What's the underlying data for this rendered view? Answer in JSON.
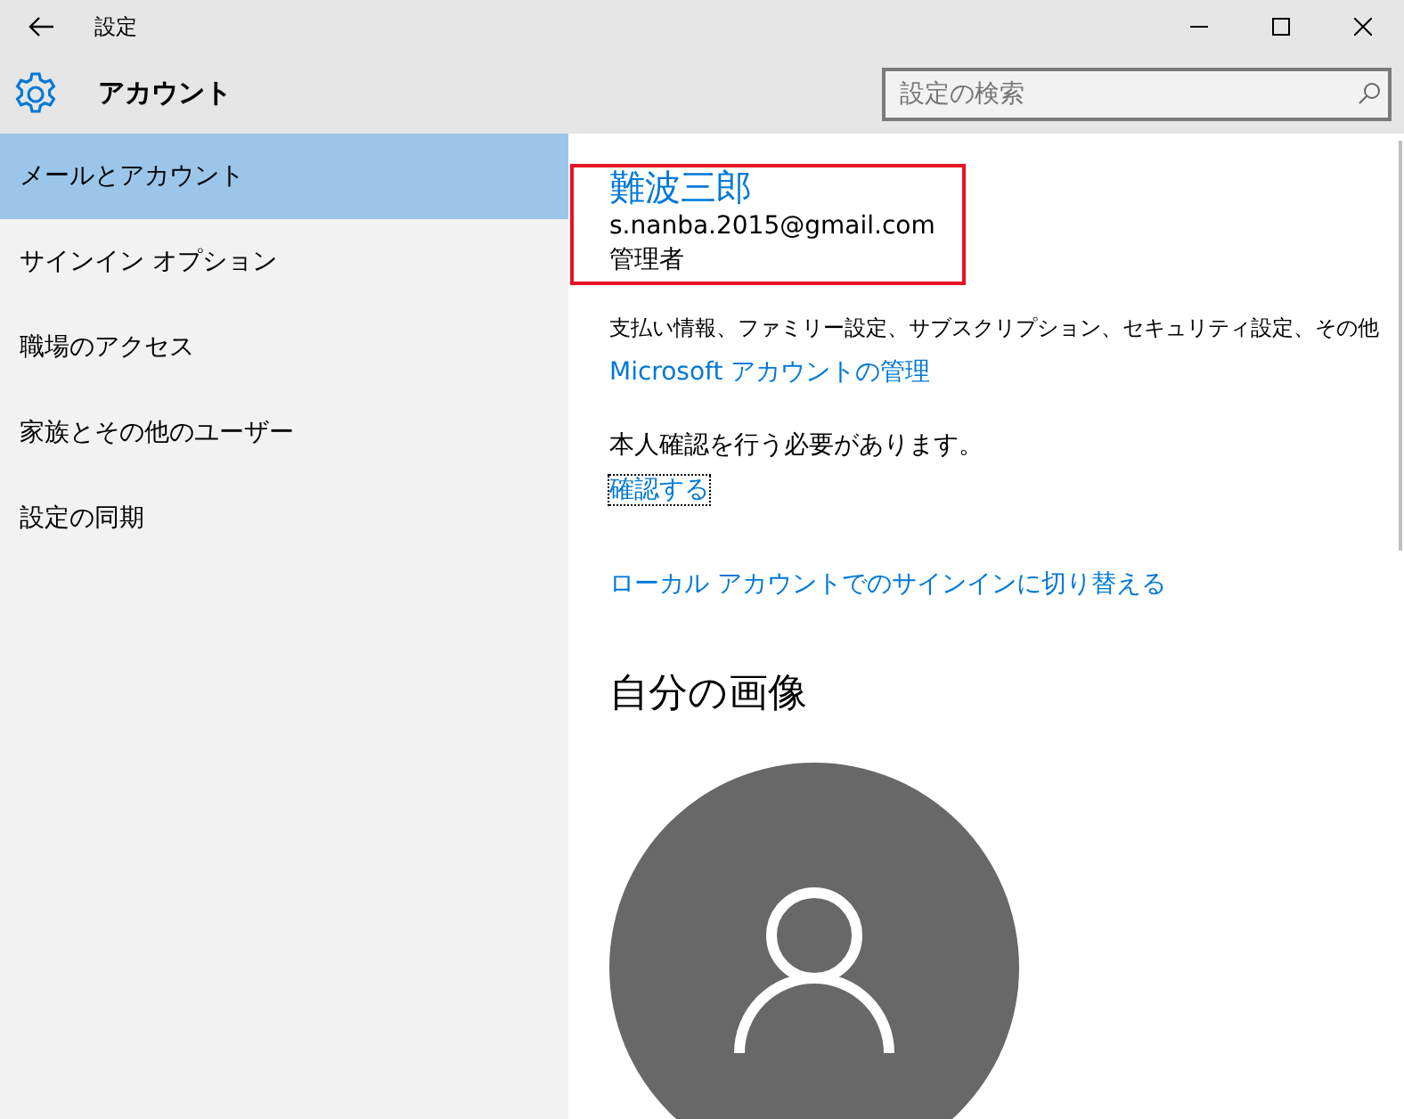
{
  "window": {
    "title": "設定"
  },
  "header": {
    "title": "アカウント",
    "search": {
      "placeholder": "設定の検索"
    }
  },
  "sidebar": {
    "items": [
      {
        "label": "メールとアカウント",
        "selected": true
      },
      {
        "label": "サインイン オプション",
        "selected": false
      },
      {
        "label": "職場のアクセス",
        "selected": false
      },
      {
        "label": "家族とその他のユーザー",
        "selected": false
      },
      {
        "label": "設定の同期",
        "selected": false
      }
    ]
  },
  "account": {
    "name": "難波三郎",
    "email": "s.nanba.2015@gmail.com",
    "highlighted": true,
    "role": "管理者",
    "description": "支払い情報、ファミリー設定、サブスクリプション、セキュリティ設定、その他",
    "manage_link": "Microsoft アカウントの管理",
    "verify_note": "本人確認を行う必要があります。",
    "verify_link": {
      "label": "確認する",
      "focused": true
    },
    "switch_link": "ローカル アカウントでのサインインに切り替える"
  },
  "picture_section": {
    "title": "自分の画像"
  }
}
